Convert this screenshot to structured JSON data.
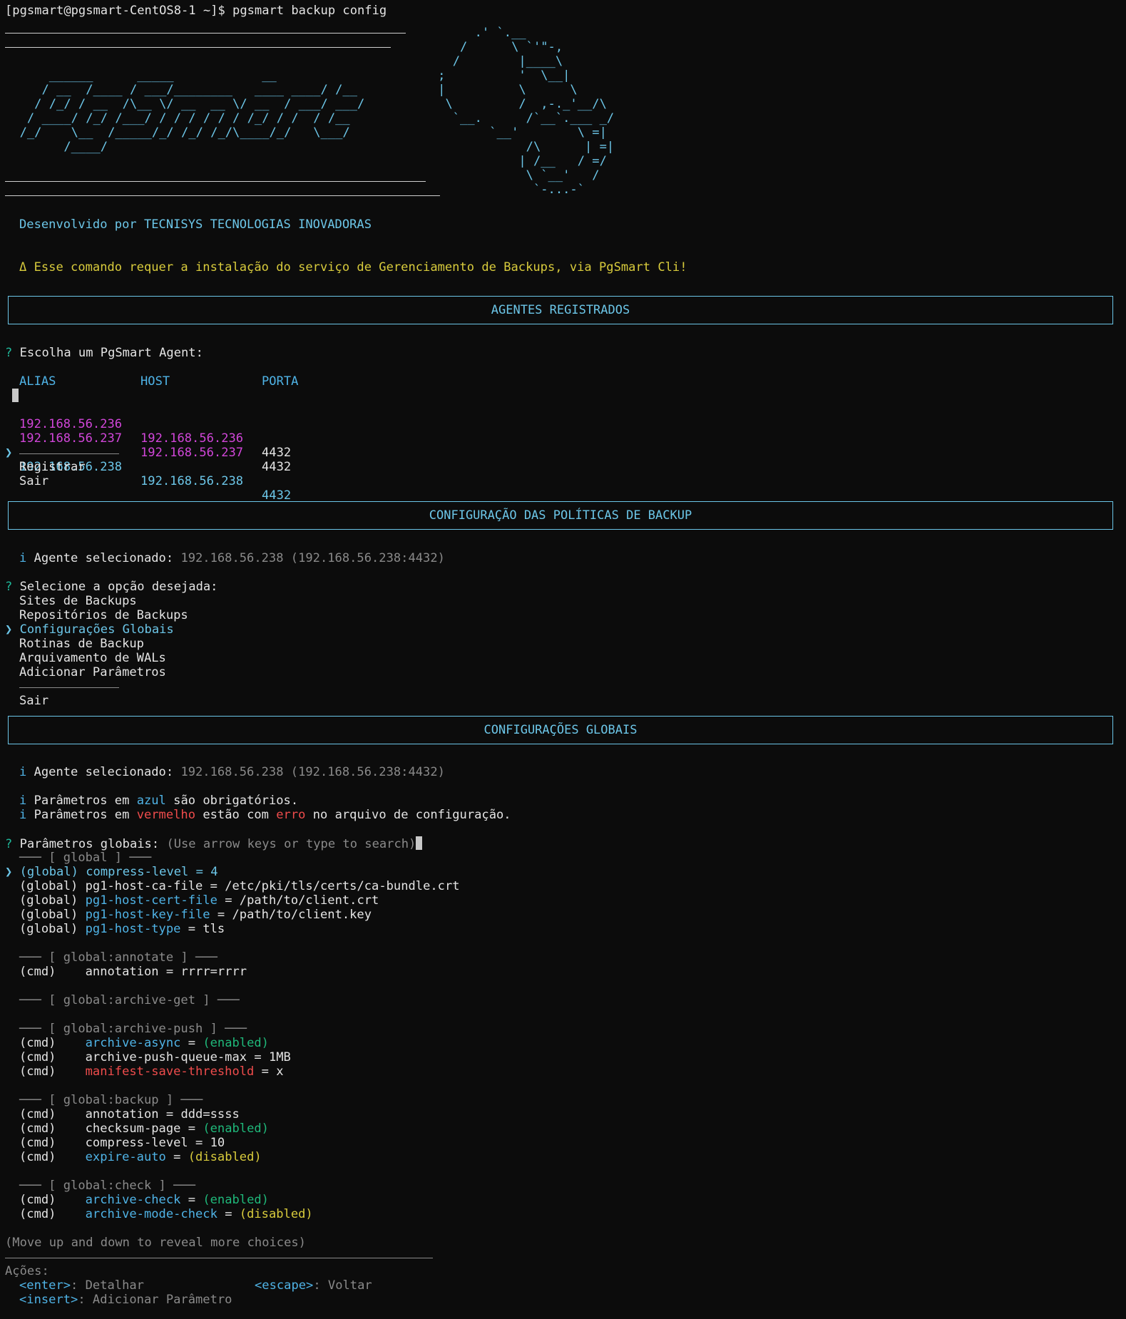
{
  "prompt": "[pgsmart@pgsmart-CentOS8-1 ~]$ pgsmart backup config",
  "logo_art": "                                                                .' `.__\n                                                              /      \\ `'\"-,\n                                                             /        |____\\\n      ______      _____            __                      ;          '  \\__|\n     / __  /____ / ___/________   ____ ____/ /__           |          \\      \\\n    / /_/ / __  /\\__ \\/ __  __ \\/ __  / ___/ ___/           \\         /  ,-._'__/\\\n   / ____/ /_/ /___/ / / / / / / /_/ / /  / /__              `__.      /`__`.___ _/\n  /_/    \\__  /_____/_/ /_/ /_/\\____/_/   \\___/                   `__'        \\ =|\n        /____/                                                         /\\      | =|\n                                                                      | /__   / =/\n                                                                       \\ `__'   /\n                                                                        `-...-`",
  "developer": "Desenvolvido por TECNISYS TECNOLOGIAS INOVADORAS",
  "warning": "Δ Esse comando requer a instalação do serviço de Gerenciamento de Backups, via PgSmart Cli!",
  "section_agents": {
    "title": "AGENTES REGISTRADOS",
    "question_mark": "?",
    "question": "Escolha um PgSmart Agent:",
    "columns": [
      "ALIAS",
      "HOST",
      "PORTA"
    ],
    "rows": [
      {
        "alias": "192.168.56.236",
        "host": "192.168.56.236",
        "port": "4432"
      },
      {
        "alias": "192.168.56.237",
        "host": "192.168.56.237",
        "port": "4432"
      },
      {
        "alias": "192.168.56.238",
        "host": "192.168.56.238",
        "port": "4432",
        "selected": true
      }
    ],
    "pointer": "❯",
    "extra_options": [
      "Registrar",
      "Sair"
    ]
  },
  "section_policies": {
    "title": "CONFIGURAÇÃO DAS POLÍTICAS DE BACKUP",
    "info_icon": "i",
    "agent_label": "Agente selecionado:",
    "agent_value": "192.168.56.238 (192.168.56.238:4432)",
    "question": "Selecione a opção desejada:",
    "options": [
      "Sites de Backups",
      "Repositórios de Backups",
      "Configurações Globais",
      "Rotinas de Backup",
      "Arquivamento de WALs",
      "Adicionar Parâmetros"
    ],
    "selected_index": 2,
    "exit": "Sair"
  },
  "section_global": {
    "title": "CONFIGURAÇÕES GLOBAIS",
    "agent_label": "Agente selecionado:",
    "agent_value": "192.168.56.238 (192.168.56.238:4432)",
    "legend_blue_pre": "Parâmetros em",
    "legend_blue_word": "azul",
    "legend_blue_post": "são obrigatórios.",
    "legend_red_pre": "Parâmetros em",
    "legend_red_word": "vermelho",
    "legend_red_mid": "estão com",
    "legend_red_word2": "erro",
    "legend_red_post": "no arquivo de configuração.",
    "question": "Parâmetros globais:",
    "hint": "(Use arrow keys or type to search)",
    "groups": [
      {
        "header": "─── [ global ] ───",
        "items": [
          {
            "scope": "(global)",
            "name": "compress-level",
            "eq": "=",
            "value": "4",
            "selected": true
          },
          {
            "scope": "(global)",
            "name": "pg1-host-ca-file",
            "eq": "=",
            "value": "/etc/pki/tls/certs/ca-bundle.crt"
          },
          {
            "scope": "(global)",
            "name": "pg1-host-cert-file",
            "eq": "=",
            "value": "/path/to/client.crt"
          },
          {
            "scope": "(global)",
            "name": "pg1-host-key-file",
            "eq": "=",
            "value": "/path/to/client.key"
          },
          {
            "scope": "(global)",
            "name": "pg1-host-type",
            "eq": "=",
            "value": "tls"
          }
        ]
      },
      {
        "header": "─── [ global:annotate ] ───",
        "items": [
          {
            "scope": "(cmd)",
            "name": "annotation",
            "eq": "=",
            "value": "rrrr=rrrr"
          }
        ]
      },
      {
        "header": "─── [ global:archive-get ] ───",
        "items": []
      },
      {
        "header": "─── [ global:archive-push ] ───",
        "items": [
          {
            "scope": "(cmd)",
            "name": "archive-async",
            "eq": "=",
            "value": "(enabled)"
          },
          {
            "scope": "(cmd)",
            "name": "archive-push-queue-max",
            "eq": "=",
            "value": "1MB"
          },
          {
            "scope": "(cmd)",
            "name": "manifest-save-threshold",
            "eq": "=",
            "value": "x"
          }
        ]
      },
      {
        "header": "─── [ global:backup ] ───",
        "items": [
          {
            "scope": "(cmd)",
            "name": "annotation",
            "eq": "=",
            "value": "ddd=ssss"
          },
          {
            "scope": "(cmd)",
            "name": "checksum-page",
            "eq": "=",
            "value": "(enabled)"
          },
          {
            "scope": "(cmd)",
            "name": "compress-level",
            "eq": "=",
            "value": "10"
          },
          {
            "scope": "(cmd)",
            "name": "expire-auto",
            "eq": "=",
            "value": "(disabled)"
          }
        ]
      },
      {
        "header": "─── [ global:check ] ───",
        "items": [
          {
            "scope": "(cmd)",
            "name": "archive-check",
            "eq": "=",
            "value": "(enabled)"
          },
          {
            "scope": "(cmd)",
            "name": "archive-mode-check",
            "eq": "=",
            "value": "(disabled)"
          }
        ]
      }
    ],
    "more_hint": "(Move up and down to reveal more choices)",
    "actions_label": "Ações:",
    "actions": [
      {
        "key": "<enter>",
        "desc": ": Detalhar"
      },
      {
        "key": "<escape>",
        "desc": ": Voltar"
      },
      {
        "key": "<insert>",
        "desc": ": Adicionar Parâmetro"
      }
    ]
  },
  "colors": {
    "cyan": "#6cc6e8",
    "blue": "#4fb3e6",
    "magenta": "#d146d9",
    "yellow": "#d8cb3c",
    "green": "#1fb87a",
    "red": "#ef4c4c",
    "background": "#0c0c0c"
  }
}
